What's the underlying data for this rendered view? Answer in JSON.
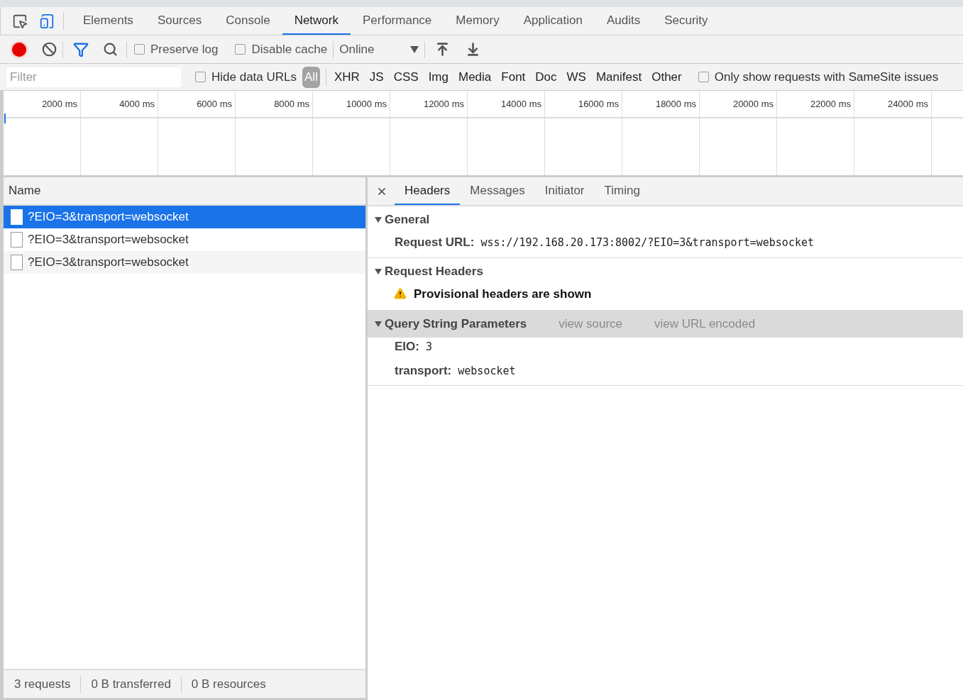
{
  "panel_tabs": [
    {
      "label": "Elements",
      "selected": false
    },
    {
      "label": "Sources",
      "selected": false
    },
    {
      "label": "Console",
      "selected": false
    },
    {
      "label": "Network",
      "selected": true
    },
    {
      "label": "Performance",
      "selected": false
    },
    {
      "label": "Memory",
      "selected": false
    },
    {
      "label": "Application",
      "selected": false
    },
    {
      "label": "Audits",
      "selected": false
    },
    {
      "label": "Security",
      "selected": false
    }
  ],
  "toolbar": {
    "recording": true,
    "preserve_log": {
      "label": "Preserve log",
      "checked": false
    },
    "disable_cache": {
      "label": "Disable cache",
      "checked": false
    },
    "throttling": "Online"
  },
  "filter_bar": {
    "placeholder": "Filter",
    "hide_data_urls": {
      "label": "Hide data URLs",
      "checked": false
    },
    "types": [
      {
        "label": "All",
        "selected": true
      },
      {
        "label": "XHR",
        "selected": false
      },
      {
        "label": "JS",
        "selected": false
      },
      {
        "label": "CSS",
        "selected": false
      },
      {
        "label": "Img",
        "selected": false
      },
      {
        "label": "Media",
        "selected": false
      },
      {
        "label": "Font",
        "selected": false
      },
      {
        "label": "Doc",
        "selected": false
      },
      {
        "label": "WS",
        "selected": false
      },
      {
        "label": "Manifest",
        "selected": false
      },
      {
        "label": "Other",
        "selected": false
      }
    ],
    "samesite": {
      "label": "Only show requests with SameSite issues",
      "checked": false
    }
  },
  "timeline": {
    "ticks": [
      "2000 ms",
      "4000 ms",
      "6000 ms",
      "8000 ms",
      "10000 ms",
      "12000 ms",
      "14000 ms",
      "16000 ms",
      "18000 ms",
      "20000 ms",
      "22000 ms",
      "24000 ms"
    ]
  },
  "requests": {
    "column": "Name",
    "rows": [
      {
        "name": "?EIO=3&transport=websocket",
        "selected": true
      },
      {
        "name": "?EIO=3&transport=websocket",
        "selected": false
      },
      {
        "name": "?EIO=3&transport=websocket",
        "selected": false
      }
    ]
  },
  "detail_tabs": [
    {
      "label": "Headers",
      "selected": true
    },
    {
      "label": "Messages",
      "selected": false
    },
    {
      "label": "Initiator",
      "selected": false
    },
    {
      "label": "Timing",
      "selected": false
    }
  ],
  "sections": [
    {
      "kind": "rows",
      "title": "General",
      "expanded": true,
      "shaded": false,
      "rows": [
        {
          "key": "Request URL:",
          "value": "wss://192.168.20.173:8002/?EIO=3&transport=websocket"
        }
      ]
    },
    {
      "kind": "warning",
      "title": "Request Headers",
      "expanded": true,
      "shaded": false,
      "warning": "Provisional headers are shown"
    },
    {
      "kind": "rows",
      "title": "Query String Parameters",
      "expanded": true,
      "shaded": true,
      "links": [
        "view source",
        "view URL encoded"
      ],
      "rows": [
        {
          "key": "EIO:",
          "value": "3"
        },
        {
          "key": "transport:",
          "value": "websocket"
        }
      ]
    }
  ],
  "status_bar": [
    "3 requests",
    "0 B transferred",
    "0 B resources"
  ]
}
